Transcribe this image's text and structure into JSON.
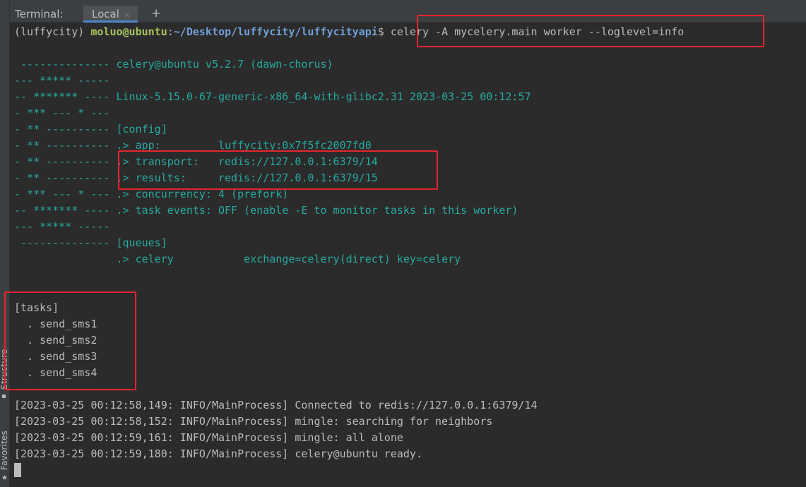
{
  "header": {
    "title": "Terminal:",
    "tab_label": "Local",
    "tab_close": "×",
    "new_tab": "+"
  },
  "side": {
    "structure_label": "Structure",
    "favorites_label": "Favorites"
  },
  "prompt": {
    "env": "(luffycity) ",
    "user_host": "moluo@ubuntu",
    "sep": ":",
    "path": "~/Desktop/luffycity/luffycityapi",
    "dollar": "$ ",
    "command": "celery -A mycelery.main worker --loglevel=info"
  },
  "banner": [
    {
      "left": " -------------- ",
      "right": "celery@ubuntu v5.2.7 (dawn-chorus)"
    },
    {
      "left": "--- ***** ----- ",
      "right": ""
    },
    {
      "left": "-- ******* ---- ",
      "right": "Linux-5.15.0-67-generic-x86_64-with-glibc2.31 2023-03-25 00:12:57"
    },
    {
      "left": "- *** --- * --- ",
      "right": ""
    },
    {
      "left": "- ** ---------- ",
      "right": "[config]"
    },
    {
      "left": "- ** ---------- ",
      "right": ".> app:         luffycity:0x7f5fc2007fd0"
    },
    {
      "left": "- ** ---------- ",
      "right": ".> transport:   redis://127.0.0.1:6379/14"
    },
    {
      "left": "- ** ---------- ",
      "right": ".> results:     redis://127.0.0.1:6379/15"
    },
    {
      "left": "- *** --- * --- ",
      "right": ".> concurrency: 4 (prefork)"
    },
    {
      "left": "-- ******* ---- ",
      "right": ".> task events: OFF (enable -E to monitor tasks in this worker)"
    },
    {
      "left": "--- ***** ----- ",
      "right": ""
    },
    {
      "left": " -------------- ",
      "right": "[queues]"
    },
    {
      "left": "                ",
      "right": ".> celery           exchange=celery(direct) key=celery"
    }
  ],
  "tasks": {
    "header": "[tasks]",
    "items": [
      "  . send_sms1",
      "  . send_sms2",
      "  . send_sms3",
      "  . send_sms4"
    ]
  },
  "logs": [
    "[2023-03-25 00:12:58,149: INFO/MainProcess] Connected to redis://127.0.0.1:6379/14",
    "[2023-03-25 00:12:58,152: INFO/MainProcess] mingle: searching for neighbors",
    "[2023-03-25 00:12:59,161: INFO/MainProcess] mingle: all alone",
    "[2023-03-25 00:12:59,180: INFO/MainProcess] celery@ubuntu ready."
  ],
  "colors": {
    "background": "#2b2b2b",
    "teal": "#28a8a0",
    "annotation": "#e3262c"
  }
}
